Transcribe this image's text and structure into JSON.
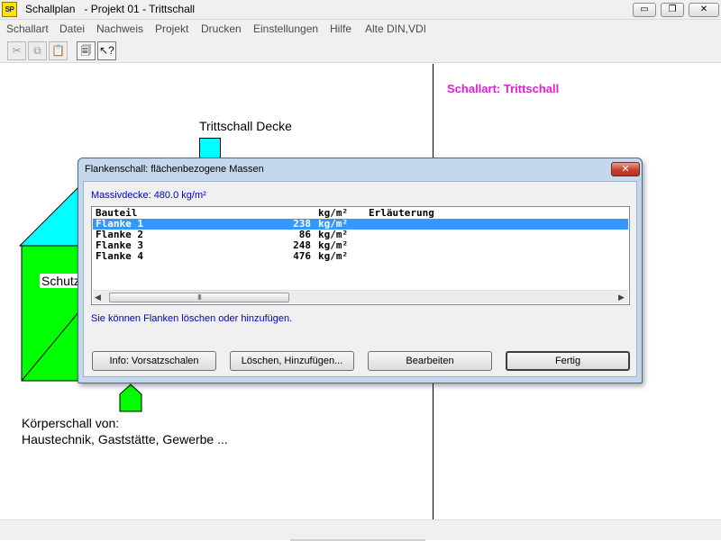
{
  "window": {
    "icon_text": "SP",
    "title": "Schallplan   - Projekt 01 - Trittschall",
    "minimize_glyph": "▭",
    "maximize_glyph": "❐",
    "close_glyph": "✕"
  },
  "menu": {
    "items": [
      "Schallart",
      "Datei",
      "Nachweis",
      "Projekt",
      "Drucken",
      "Einstellungen",
      "Hilfe",
      "Alte DIN,VDI"
    ]
  },
  "toolbar": {
    "buttons": [
      {
        "icon": "scissors-icon",
        "glyph": "✂"
      },
      {
        "icon": "copy-icon",
        "glyph": "⧉"
      },
      {
        "icon": "paste-icon",
        "glyph": "📋"
      },
      {
        "icon": "properties-icon",
        "glyph": "🗐"
      },
      {
        "icon": "help-pointer-icon",
        "glyph": "↖?"
      }
    ]
  },
  "canvas": {
    "schallart_label": "Schallart: Trittschall",
    "ceiling_label": "Trittschall Decke",
    "room_label": "Schutz",
    "koerperschall_line1": "Körperschall von:",
    "koerperschall_line2": "Haustechnik, Gaststätte, Gewerbe ...",
    "colors": {
      "ceiling": "#00ffff",
      "room": "#00ff00",
      "schallart_text": "#e01ed8"
    }
  },
  "dialog": {
    "title": "Flankenschall: flächenbezogene Massen",
    "close_glyph": "✕",
    "massivdecke_label": "Massivdecke: 480.0 kg/m²",
    "list": {
      "headers": {
        "name": "Bauteil",
        "unit": "kg/m²",
        "desc": "Erläuterung"
      },
      "rows": [
        {
          "name": "Flanke 1",
          "value": "238",
          "unit": "kg/m²",
          "desc": "",
          "selected": true
        },
        {
          "name": "Flanke 2",
          "value": "86",
          "unit": "kg/m²",
          "desc": "",
          "selected": false
        },
        {
          "name": "Flanke 3",
          "value": "248",
          "unit": "kg/m²",
          "desc": "",
          "selected": false
        },
        {
          "name": "Flanke 4",
          "value": "476",
          "unit": "kg/m²",
          "desc": "",
          "selected": false
        }
      ],
      "scroll_left": "◀",
      "scroll_right": "▶",
      "scroll_thumb": "III"
    },
    "hint": "Sie können Flanken löschen oder hinzufügen.",
    "buttons": {
      "info": "Info: Vorsatzschalen",
      "loeschen": "Löschen, Hinzufügen...",
      "bearbeiten": "Bearbeiten",
      "fertig": "Fertig"
    },
    "selection_color": "#3399ff"
  }
}
